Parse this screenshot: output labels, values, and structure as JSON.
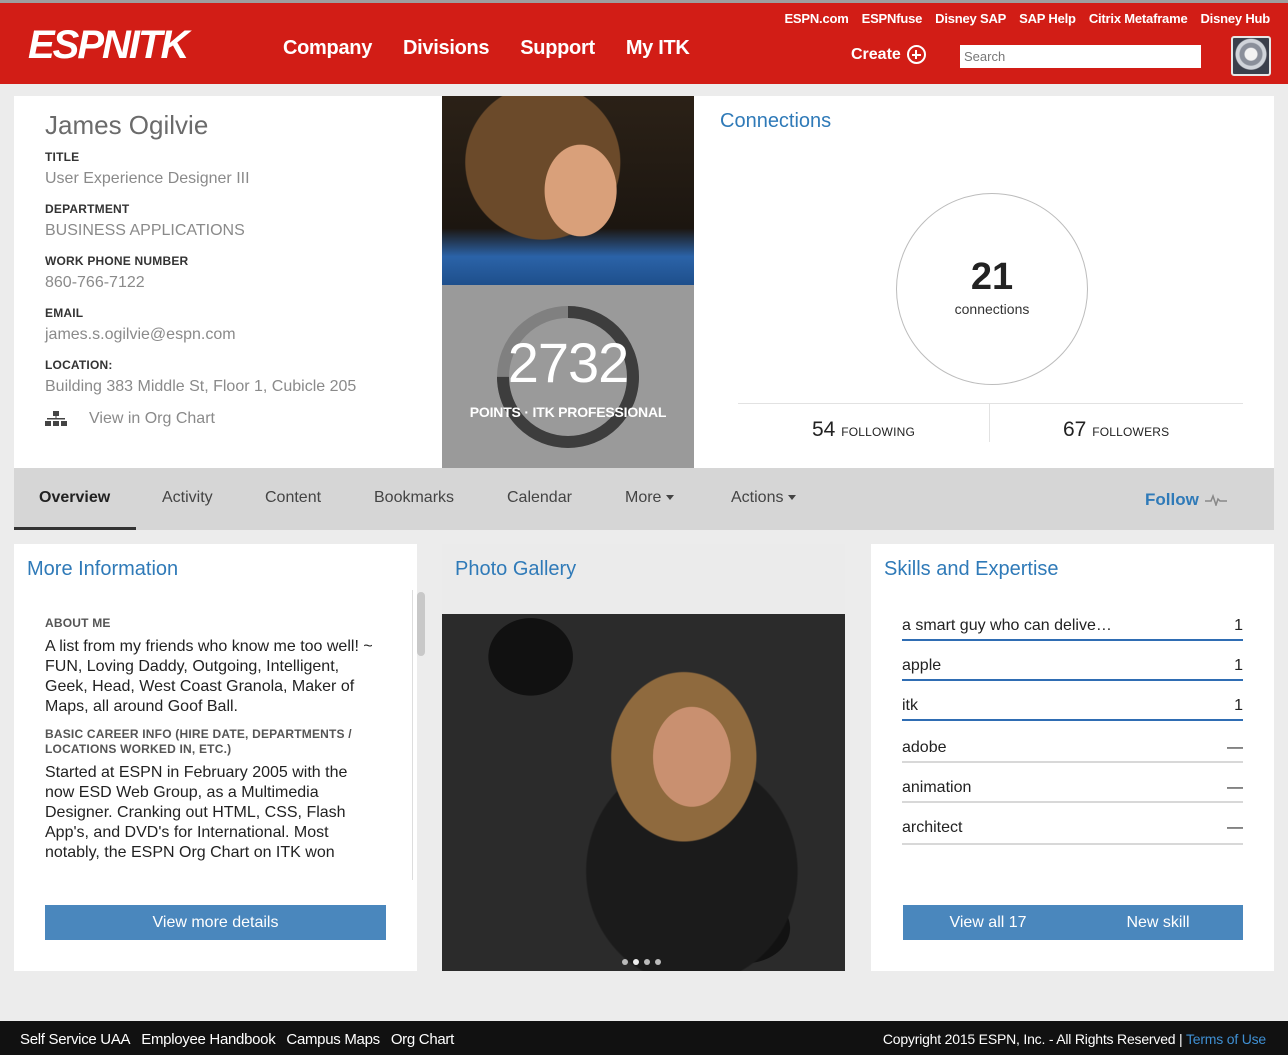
{
  "header": {
    "logo_text": "ESPNITK",
    "main_nav": [
      "Company",
      "Divisions",
      "Support",
      "My ITK"
    ],
    "top_links": [
      "ESPN.com",
      "ESPNfuse",
      "Disney SAP",
      "SAP Help",
      "Citrix Metaframe",
      "Disney Hub"
    ],
    "create_label": "Create",
    "search_placeholder": "Search"
  },
  "profile": {
    "name": "James Ogilvie",
    "title_label": "TITLE",
    "title": "User Experience Designer III",
    "department_label": "DEPARTMENT",
    "department": "BUSINESS APPLICATIONS",
    "phone_label": "WORK PHONE NUMBER",
    "phone": "860-766-7122",
    "email_label": "EMAIL",
    "email": "james.s.ogilvie@espn.com",
    "location_label": "LOCATION:",
    "location": "Building 383 Middle St, Floor 1, Cubicle 205",
    "org_chart_link": "View in Org Chart"
  },
  "points": {
    "value": "2732",
    "label": "POINTS · ITK PROFESSIONAL",
    "ring_progress": 0.75
  },
  "connections": {
    "title": "Connections",
    "count": "21",
    "count_label": "connections",
    "following_count": "54",
    "following_label": "FOLLOWING",
    "followers_count": "67",
    "followers_label": "FOLLOWERS"
  },
  "tabs": {
    "items": [
      "Overview",
      "Activity",
      "Content",
      "Bookmarks",
      "Calendar",
      "More",
      "Actions"
    ],
    "active": "Overview",
    "follow_label": "Follow"
  },
  "more_info": {
    "title": "More Information",
    "about_label": "ABOUT ME",
    "about_text": "A list from my friends who know me too well! ~ FUN, Loving Daddy, Outgoing, Intelligent, Geek, Head, West Coast Granola, Maker of Maps, all around Goof Ball.",
    "career_label": "BASIC CAREER INFO (HIRE DATE, DEPARTMENTS / LOCATIONS WORKED IN, ETC.)",
    "career_text": "Started at ESPN in February 2005 with the now ESD Web Group, as a Multimedia Designer. Cranking out HTML, CSS, Flash App's, and DVD's for International. Most notably, the ESPN Org Chart on ITK won",
    "button": "View more details"
  },
  "gallery": {
    "title": "Photo Gallery",
    "slide_count": 4,
    "active_slide": 1
  },
  "skills": {
    "title": "Skills and Expertise",
    "items": [
      {
        "name": "a smart guy who can delive…",
        "count": "1"
      },
      {
        "name": "apple",
        "count": "1"
      },
      {
        "name": "itk",
        "count": "1"
      },
      {
        "name": "adobe",
        "count": "—"
      },
      {
        "name": "animation",
        "count": "—"
      },
      {
        "name": "architect",
        "count": "—"
      }
    ],
    "view_all": "View all 17",
    "new_skill": "New skill",
    "accent_color": "#2f6db3"
  },
  "footer": {
    "links": [
      "Self Service UAA",
      "Employee Handbook",
      "Campus Maps",
      "Org Chart"
    ],
    "copyright": "Copyright 2015 ESPN, Inc. - All Rights Reserved |",
    "terms": "Terms of Use"
  }
}
